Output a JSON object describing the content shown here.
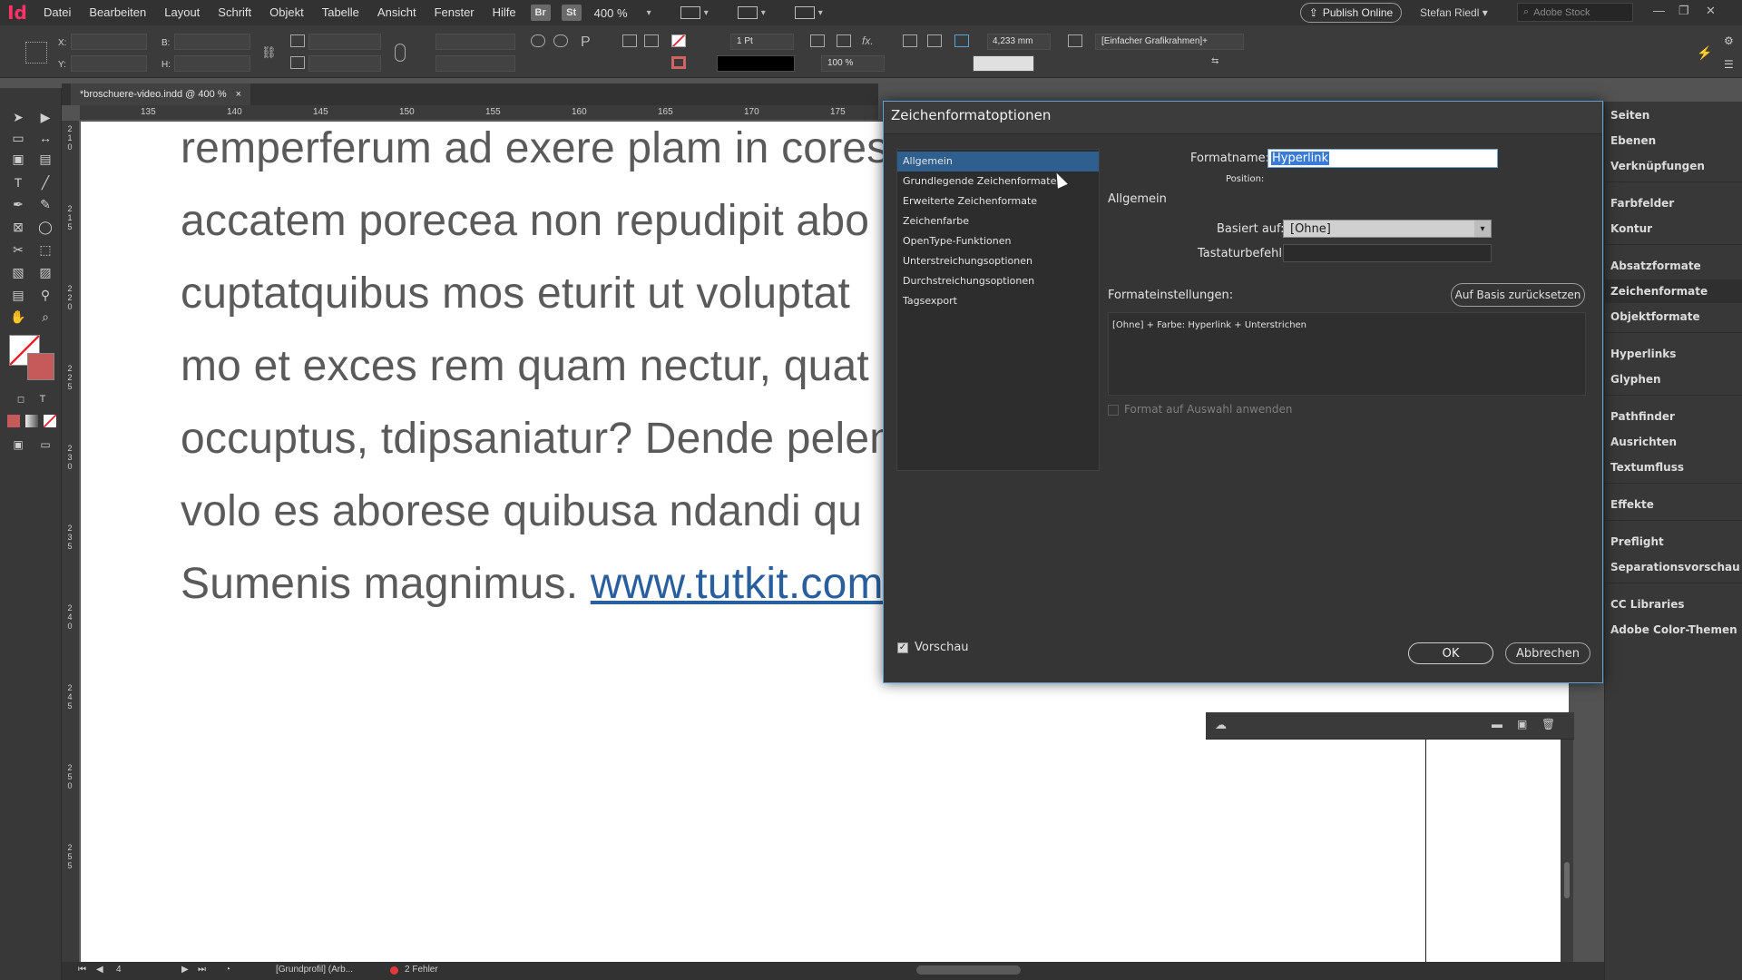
{
  "app": {
    "logo": "Id"
  },
  "menu": [
    "Datei",
    "Bearbeiten",
    "Layout",
    "Schrift",
    "Objekt",
    "Tabelle",
    "Ansicht",
    "Fenster",
    "Hilfe"
  ],
  "menubar": {
    "br_label": "Br",
    "st_label": "St",
    "zoom": "400 %",
    "publish_label": "Publish Online",
    "user": "Stefan Riedl",
    "search_placeholder": "Adobe Stock"
  },
  "control": {
    "x_label": "X:",
    "y_label": "Y:",
    "w_label": "B:",
    "h_label": "H:",
    "stroke_weight": "1 Pt",
    "scale_value": "100 %",
    "dimension_value": "4,233 mm",
    "frame_style": "[Einfacher Grafikrahmen]+"
  },
  "document": {
    "tab_label": "*broschuere-video.indd @ 400 %",
    "tab_close": "×",
    "ruler_ticks": [
      "135",
      "140",
      "145",
      "150",
      "155",
      "160",
      "165",
      "170",
      "175"
    ],
    "ruler_vertical": [
      "2 1 0",
      "2 1 5",
      "2 2 0",
      "2 2 5",
      "2 3 0",
      "2 3 5",
      "2 4 0",
      "2 4 5",
      "2 5 0",
      "2 5 5"
    ],
    "lines": [
      "remperferum ad exere plam in coresu",
      "accatem porecea non repudipit abo",
      "cuptatquibus mos eturit ut voluptat",
      "mo et exces rem quam nectur, quat o",
      "occuptus, tdipsaniatur? Dende pelent",
      "volo es aborese quibusa ndandi qu"
    ],
    "last_line_prefix": "Sumenis magnimus. ",
    "link_text": "www.tutkit.com"
  },
  "status": {
    "page": "4",
    "profile": "[Grundprofil] (Arb...",
    "errors": "2 Fehler"
  },
  "dock": [
    "Seiten",
    "Ebenen",
    "Verknüpfungen",
    "Farbfelder",
    "Kontur",
    "Absatzformate",
    "Zeichenformate",
    "Objektformate",
    "Hyperlinks",
    "Glyphen",
    "Pathfinder",
    "Ausrichten",
    "Textumfluss",
    "Effekte",
    "Preflight",
    "Separationsvorschau",
    "CC Libraries",
    "Adobe Color-Themen"
  ],
  "dialog": {
    "title": "Zeichenformatoptionen",
    "categories": [
      "Allgemein",
      "Grundlegende Zeichenformate",
      "Erweiterte Zeichenformate",
      "Zeichenfarbe",
      "OpenType-Funktionen",
      "Unterstreichungsoptionen",
      "Durchstreichungsoptionen",
      "Tagsexport"
    ],
    "selected_category": "Allgemein",
    "formatname_label": "Formatname:",
    "formatname_value": "Hyperlink",
    "position_label": "Position:",
    "section_label": "Allgemein",
    "based_on_label": "Basiert auf:",
    "based_on_value": "[Ohne]",
    "shortcut_label": "Tastaturbefehl:",
    "settings_label": "Formateinstellungen:",
    "reset_label": "Auf Basis zurücksetzen",
    "settings_text": "[Ohne] + Farbe: Hyperlink + Unterstrichen",
    "apply_label": "Format auf Auswahl anwenden",
    "preview_label": "Vorschau",
    "ok_label": "OK",
    "cancel_label": "Abbrechen"
  },
  "colors": {
    "accent": "#5aa3d9",
    "selection": "#2f5f8f",
    "link": "#2a5f9e",
    "logo": "#ff3366"
  }
}
